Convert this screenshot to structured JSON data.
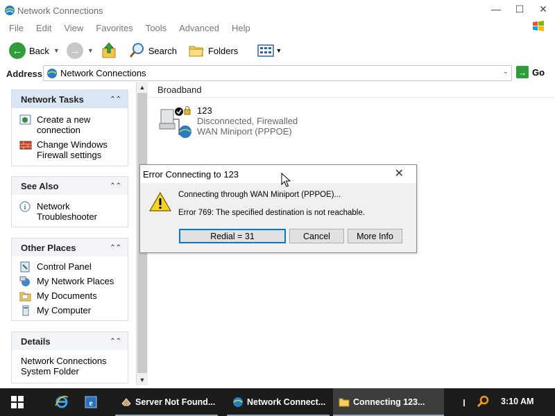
{
  "window": {
    "title": "Network Connections",
    "controls": {
      "minimize": "—",
      "maximize": "☐",
      "close": "✕"
    }
  },
  "menu": [
    "File",
    "Edit",
    "View",
    "Favorites",
    "Tools",
    "Advanced",
    "Help"
  ],
  "toolbar": {
    "back": "Back",
    "search": "Search",
    "folders": "Folders"
  },
  "address": {
    "label": "Address",
    "value": "Network Connections",
    "go": "Go"
  },
  "left_panel": {
    "network_tasks": {
      "title": "Network Tasks",
      "items": [
        "Create a new connection",
        "Change Windows Firewall settings"
      ]
    },
    "see_also": {
      "title": "See Also",
      "items": [
        "Network Troubleshooter"
      ]
    },
    "other_places": {
      "title": "Other Places",
      "items": [
        "Control Panel",
        "My Network Places",
        "My Documents",
        "My Computer"
      ]
    },
    "details": {
      "title": "Details",
      "line1": "Network Connections",
      "line2": "System Folder"
    }
  },
  "content": {
    "group": "Broadband",
    "connection": {
      "name": "123",
      "status": "Disconnected, Firewalled",
      "device": "WAN Miniport (PPPOE)"
    }
  },
  "dialog": {
    "title": "Error Connecting to 123",
    "message1": "Connecting through WAN Miniport (PPPOE)...",
    "message2": "Error 769: The specified destination is not reachable.",
    "redial": "Redial = 31",
    "cancel": "Cancel",
    "more_info": "More Info"
  },
  "taskbar": {
    "tasks": [
      "Server Not Found...",
      "Network Connect...",
      "Connecting 123..."
    ],
    "clock": "3:10 AM"
  }
}
